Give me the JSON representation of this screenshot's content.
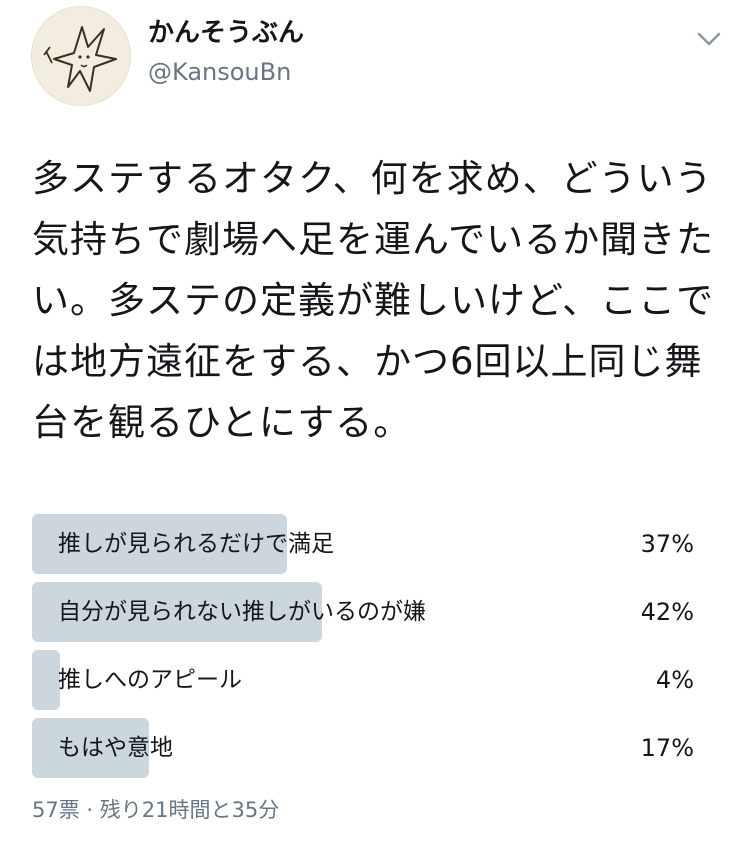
{
  "user": {
    "display_name": "かんそうぶん",
    "handle": "@KansouBn"
  },
  "tweet": {
    "text": "多ステするオタク、何を求め、どういう気持ちで劇場へ足を運んでいるか聞きたい。多ステの定義が難しいけど、ここでは地方遠征をする、かつ6回以上同じ舞台を観るひとにする。"
  },
  "poll": {
    "options": [
      {
        "label": "推しが見られるだけで満足",
        "percent_text": "37%",
        "percent": 37
      },
      {
        "label": "自分が見られない推しがいるのが嫌",
        "percent_text": "42%",
        "percent": 42
      },
      {
        "label": "推しへのアピール",
        "percent_text": "4%",
        "percent": 4
      },
      {
        "label": "もはや意地",
        "percent_text": "17%",
        "percent": 17
      }
    ],
    "footer": "57票 · 残り21時間と35分"
  },
  "icons": {
    "avatar": "hand-drawn-star-character-avatar",
    "menu": "chevron-down-icon"
  },
  "colors": {
    "bar": "#ccd6dd",
    "secondary_text": "#657786"
  }
}
